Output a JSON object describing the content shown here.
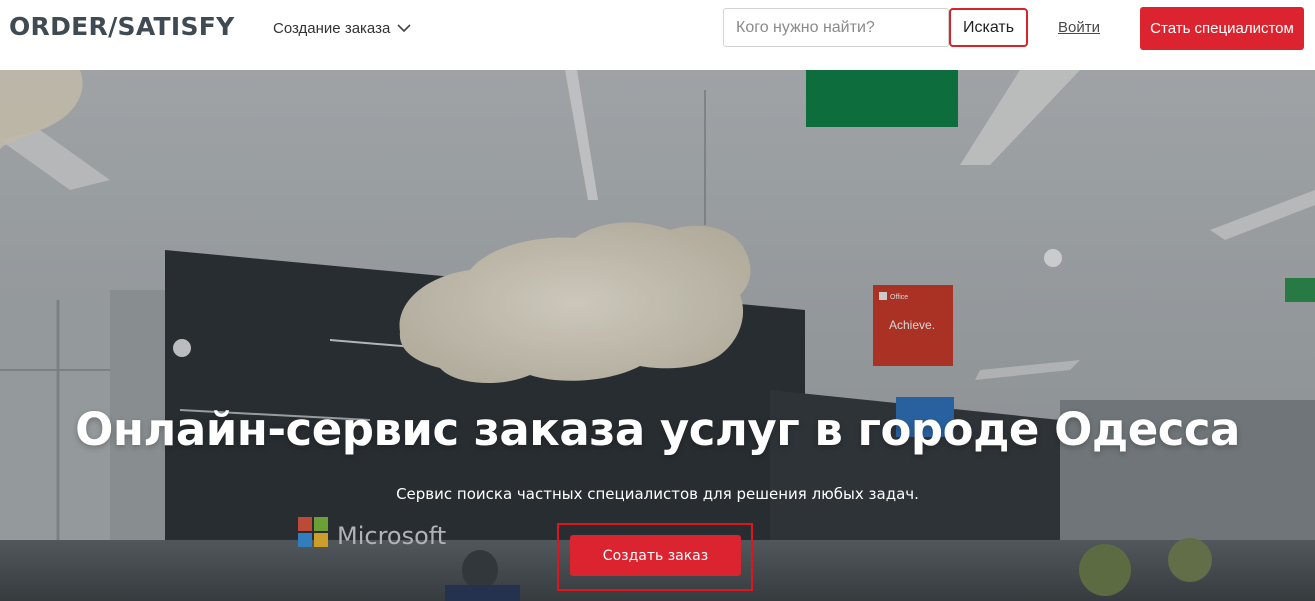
{
  "header": {
    "logo": "ORDER/SATISFY",
    "nav_dropdown_label": "Создание заказа",
    "search": {
      "placeholder": "Кого нужно найти?",
      "value": "",
      "button_label": "Искать"
    },
    "login_label": "Войти",
    "become_specialist_label": "Стать специалистом"
  },
  "hero": {
    "title": "Онлайн-сервис заказа услуг в городе Одесса",
    "subtitle": "Сервис поиска частных специалистов для решения любых задач.",
    "cta_label": "Создать заказ",
    "background_signs": {
      "office_sign_brand": "Office",
      "office_sign_text": "Achieve.",
      "wall_logo_text": "Microsoft"
    }
  },
  "colors": {
    "accent_red": "#dc2430",
    "highlight_red": "#e0141c",
    "logo_gray": "#3f4a52"
  }
}
